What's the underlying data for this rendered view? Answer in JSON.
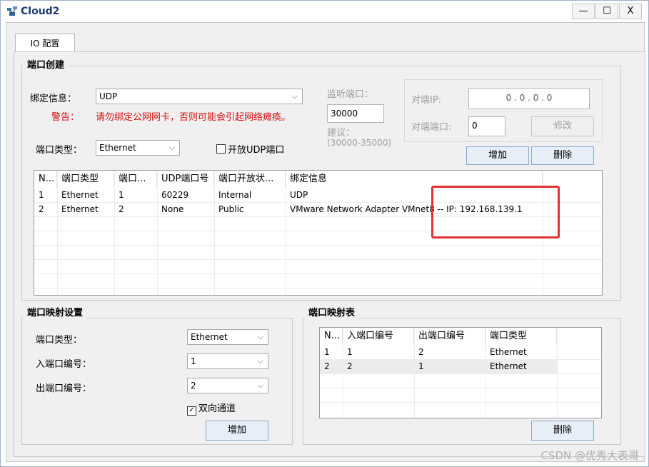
{
  "window": {
    "title": "Cloud2",
    "controls": {
      "minimize": "—",
      "maximize": "☐",
      "close": "X"
    }
  },
  "tabs": [
    {
      "label": "IO 配置"
    }
  ],
  "port_create": {
    "group_label": "端口创建",
    "bind_info_label": "绑定信息：",
    "bind_value": "UDP",
    "warning_label": "警告：",
    "warning_text": "请勿绑定公网网卡，否则可能会引起网络瘫痪。",
    "port_type_label": "端口类型：",
    "port_type_value": "Ethernet",
    "open_udp_label": "开放UDP端口",
    "listen_port_label": "监听端口：",
    "listen_port_value": "30000",
    "suggest_label": "建议：",
    "suggest_range": "(30000-35000)",
    "peer_ip_label": "对端IP:",
    "peer_ip_value": "0 . 0 . 0 . 0",
    "peer_port_label": "对端端口:",
    "peer_port_value": "0",
    "modify_button": "修改",
    "add_button": "增加",
    "delete_button": "删除",
    "table": {
      "columns": [
        "N...",
        "端口类型",
        "端口...",
        "UDP端口号",
        "端口开放状...",
        "绑定信息"
      ],
      "rows": [
        [
          "1",
          "Ethernet",
          "1",
          "60229",
          "Internal",
          "UDP"
        ],
        [
          "2",
          "Ethernet",
          "2",
          "None",
          "Public",
          "VMware Network Adapter VMnet8 -- IP: 192.168.139.1"
        ]
      ]
    }
  },
  "port_mapping_settings": {
    "group_label": "端口映射设置",
    "port_type_label": "端口类型：",
    "port_type_value": "Ethernet",
    "in_port_label": "入端口编号：",
    "in_port_value": "1",
    "out_port_label": "出端口编号：",
    "out_port_value": "2",
    "bidirectional_label": "双向通道",
    "add_button": "增加"
  },
  "port_mapping_table": {
    "group_label": "端口映射表",
    "columns": [
      "N...",
      "入端口编号",
      "出端口编号",
      "端口类型"
    ],
    "rows": [
      [
        "1",
        "1",
        "2",
        "Ethernet"
      ],
      [
        "2",
        "2",
        "1",
        "Ethernet"
      ]
    ],
    "delete_button": "删除"
  },
  "watermark": "CSDN @优秀大表哥",
  "colors": {
    "warning": "#d41010",
    "highlight_box": "#e23232",
    "title": "#1a3c6e"
  }
}
